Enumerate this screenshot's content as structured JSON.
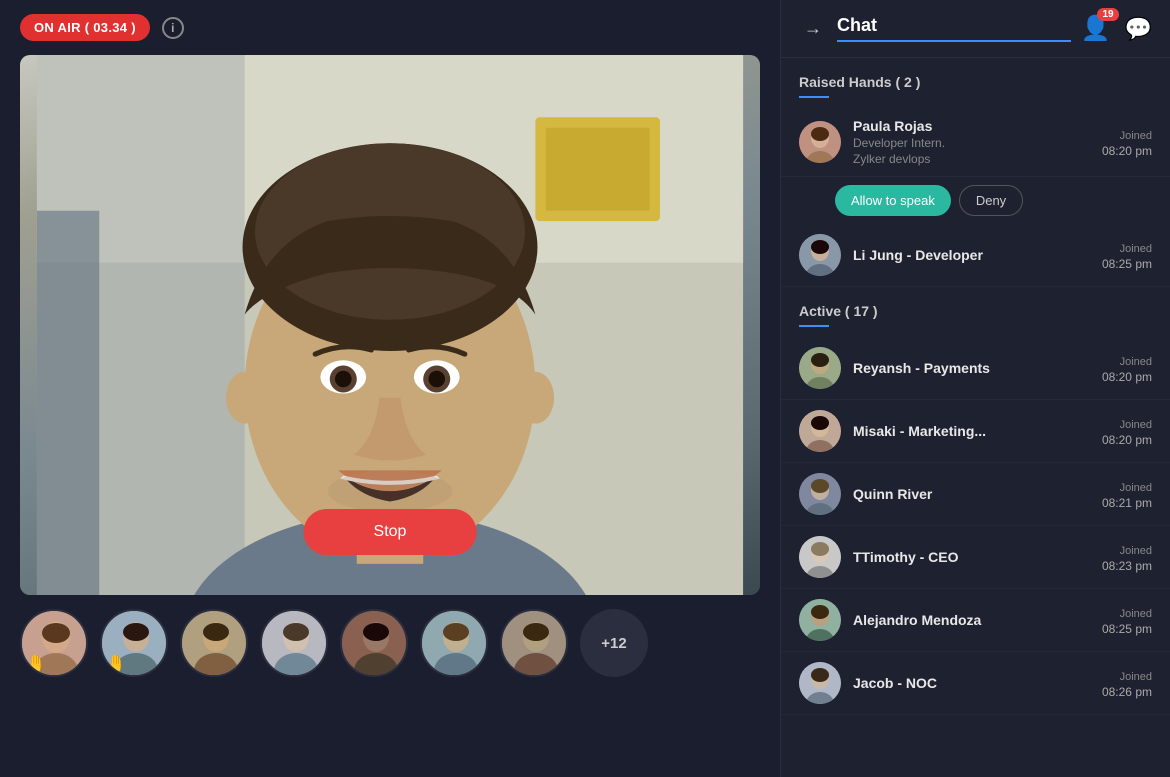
{
  "on_air": {
    "label": "ON AIR ( 03.34 )",
    "info": "i"
  },
  "stop_button": "Stop",
  "chat_header": {
    "title": "Chat",
    "back": "→",
    "badge": "19"
  },
  "raised_hands": {
    "section_label": "Raised Hands ( 2 )",
    "participants": [
      {
        "name": "Paula Rojas",
        "role": "Developer Intern.",
        "org": "Zylker devlops",
        "joined_label": "Joined",
        "time": "08:20 pm",
        "allow_label": "Allow to speak",
        "deny_label": "Deny"
      },
      {
        "name": "Li Jung - Developer",
        "role": "",
        "org": "",
        "joined_label": "Joined",
        "time": "08:25 pm"
      }
    ]
  },
  "active": {
    "section_label": "Active  ( 17 )",
    "participants": [
      {
        "name": "Reyansh - Payments",
        "joined_label": "Joined",
        "time": "08:20 pm"
      },
      {
        "name": "Misaki - Marketing...",
        "joined_label": "Joined",
        "time": "08:20 pm"
      },
      {
        "name": "Quinn River",
        "joined_label": "Joined",
        "time": "08:21 pm"
      },
      {
        "name": "TTimothy - CEO",
        "joined_label": "Joined",
        "time": "08:23 pm"
      },
      {
        "name": "Alejandro Mendoza",
        "joined_label": "Joined",
        "time": "08:25 pm"
      },
      {
        "name": "Jacob - NOC",
        "joined_label": "Joined",
        "time": "08:26 pm"
      }
    ]
  },
  "strip_participants": [
    {
      "id": 1,
      "hand": true
    },
    {
      "id": 2,
      "hand": true
    },
    {
      "id": 3,
      "hand": false
    },
    {
      "id": 4,
      "hand": false
    },
    {
      "id": 5,
      "hand": false
    },
    {
      "id": 6,
      "hand": false
    },
    {
      "id": 7,
      "hand": false
    }
  ],
  "more_count": "+12",
  "colors": {
    "accent_blue": "#3a8fff",
    "accent_teal": "#2ab8a0",
    "on_air_red": "#e03030",
    "stop_red": "#e84040"
  }
}
